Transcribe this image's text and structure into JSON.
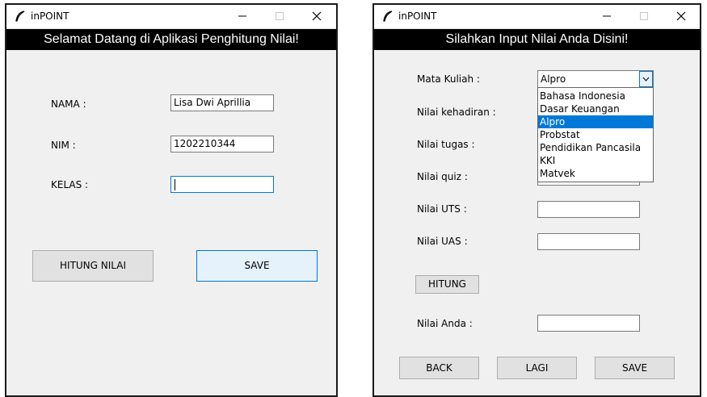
{
  "window1": {
    "title": "inPOINT",
    "banner": "Selamat Datang di Aplikasi Penghitung Nilai!",
    "fields": [
      {
        "label": "NAMA :",
        "value": "Lisa Dwi Aprillia"
      },
      {
        "label": "NIM :",
        "value": "1202210344"
      },
      {
        "label": "KELAS :",
        "value": ""
      }
    ],
    "buttons": {
      "hitung": "HITUNG NILAI",
      "save": "SAVE"
    }
  },
  "window2": {
    "title": "inPOINT",
    "banner": "Silahkan Input Nilai Anda Disini!",
    "mata_kuliah": {
      "label": "Mata Kuliah :",
      "selected": "Alpro",
      "options": [
        "Bahasa Indonesia",
        "Dasar Keuangan",
        "Alpro",
        "Probstat",
        "Pendidikan Pancasila",
        "KKI",
        "Matvek"
      ]
    },
    "fields": [
      {
        "label": "Nilai kehadiran :",
        "value": ""
      },
      {
        "label": "Nilai tugas :",
        "value": ""
      },
      {
        "label": "Nilai quiz :",
        "value": ""
      },
      {
        "label": "Nilai UTS :",
        "value": ""
      },
      {
        "label": "Nilai UAS :",
        "value": ""
      }
    ],
    "hitung_label": "HITUNG",
    "result": {
      "label": "Nilai Anda :",
      "value": ""
    },
    "buttons": {
      "back": "BACK",
      "lagi": "LAGI",
      "save": "SAVE"
    }
  },
  "colors": {
    "accent": "#0078d7",
    "banner_bg": "#000000",
    "window_bg": "#f0f0f0"
  },
  "icons": [
    "feather-icon",
    "minimize-icon",
    "maximize-icon",
    "close-icon",
    "chevron-down-icon"
  ]
}
